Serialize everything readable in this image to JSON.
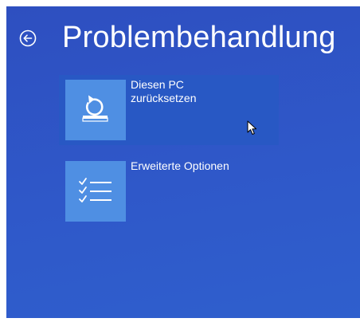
{
  "header": {
    "title": "Problembehandlung",
    "back_icon": "back-arrow-circle-icon"
  },
  "options": [
    {
      "label_lines": [
        "Diesen PC",
        "zurücksetzen"
      ],
      "icon": "reset-pc-icon",
      "selected": true
    },
    {
      "label_lines": [
        "Erweiterte Optionen"
      ],
      "icon": "checklist-icon",
      "selected": false
    }
  ],
  "colors": {
    "background": "#2f55c6",
    "tile": "#4f8fe3",
    "selected_highlight": "#2858c4",
    "text": "#ffffff"
  }
}
